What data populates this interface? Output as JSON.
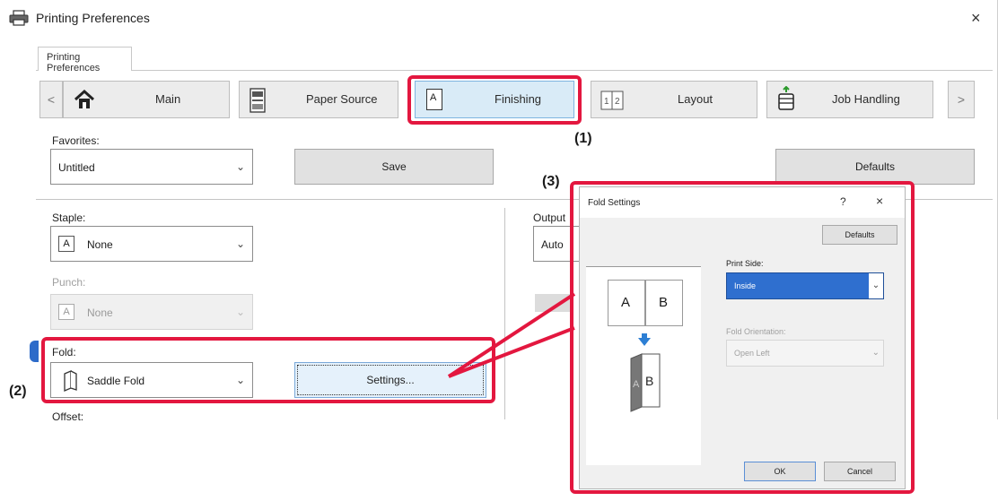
{
  "window": {
    "title": "Printing Preferences",
    "close": "×",
    "tab": "Printing Preferences"
  },
  "nav": {
    "prev": "<",
    "next": ">",
    "items": [
      {
        "label": "Main",
        "icon": "home-icon"
      },
      {
        "label": "Paper Source",
        "icon": "printer-tray-icon"
      },
      {
        "label": "Finishing",
        "icon": "page-a-icon",
        "selected": true
      },
      {
        "label": "Layout",
        "icon": "two-up-layout-icon"
      },
      {
        "label": "Job Handling",
        "icon": "job-handling-icon"
      }
    ]
  },
  "favorites": {
    "label": "Favorites:",
    "value": "Untitled",
    "save_label": "Save",
    "defaults_label": "Defaults"
  },
  "staple": {
    "label": "Staple:",
    "value": "None"
  },
  "punch": {
    "label": "Punch:",
    "value": "None"
  },
  "fold": {
    "label": "Fold:",
    "value": "Saddle Fold",
    "settings_label": "Settings..."
  },
  "offset": {
    "label": "Offset:"
  },
  "output": {
    "label": "Output",
    "value": "Auto"
  },
  "callouts": {
    "one": "(1)",
    "two": "(2)",
    "three": "(3)"
  },
  "dialog": {
    "title": "Fold Settings",
    "help": "?",
    "close": "×",
    "defaults_label": "Defaults",
    "print_side_label": "Print Side:",
    "print_side_value": "Inside",
    "fold_orientation_label": "Fold Orientation:",
    "fold_orientation_value": "Open Left",
    "ok_label": "OK",
    "cancel_label": "Cancel",
    "preview": {
      "page_left": "A",
      "page_right": "B",
      "folded_front": "B",
      "folded_back": "A"
    }
  },
  "colors": {
    "highlight": "#e3173f",
    "selected_tab": "#d9ebf7",
    "selection": "#2f6fcf"
  }
}
